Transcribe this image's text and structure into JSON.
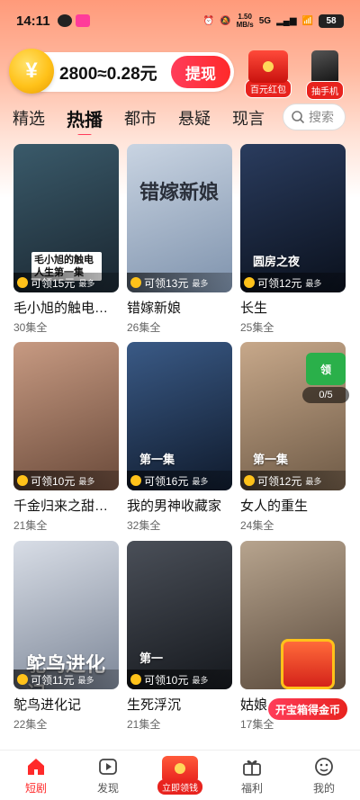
{
  "status_bar": {
    "time": "14:11",
    "net_speed_value": "1.50",
    "net_speed_unit": "MB/s",
    "network": "5G",
    "battery": "58"
  },
  "coin_bar": {
    "balance_text": "2800≈0.28元",
    "withdraw_label": "提现"
  },
  "promos": {
    "red_packet_label": "百元红包",
    "phone_label": "抽手机"
  },
  "tabs": [
    {
      "label": "精选",
      "active": false
    },
    {
      "label": "热播",
      "active": true
    },
    {
      "label": "都市",
      "active": false
    },
    {
      "label": "悬疑",
      "active": false
    },
    {
      "label": "现言",
      "active": false
    },
    {
      "label": "古",
      "active": false
    }
  ],
  "search": {
    "placeholder": "搜索"
  },
  "cards": [
    {
      "title": "毛小旭的触电…",
      "eps": "30集全",
      "reward": "可领15元",
      "max": "最多",
      "caption": "毛小旭的触电人生第一集",
      "color_a": "#3a5a6a",
      "color_b": "#1a2630"
    },
    {
      "title": "错嫁新娘",
      "eps": "26集全",
      "reward": "可领13元",
      "max": "最多",
      "caption": "错嫁新娘",
      "color_a": "#c9d4e2",
      "color_b": "#7f93ad"
    },
    {
      "title": "长生",
      "eps": "25集全",
      "reward": "可领12元",
      "max": "最多",
      "caption": "圆房之夜",
      "color_a": "#2a3c5e",
      "color_b": "#0a101c"
    },
    {
      "title": "千金归来之甜…",
      "eps": "21集全",
      "reward": "可领10元",
      "max": "最多",
      "caption": "",
      "color_a": "#c79a82",
      "color_b": "#6a4a3a"
    },
    {
      "title": "我的男神收藏家",
      "eps": "32集全",
      "reward": "可领16元",
      "max": "最多",
      "caption": "第一集",
      "color_a": "#3a5a86",
      "color_b": "#0f1a2c"
    },
    {
      "title": "女人的重生",
      "eps": "24集全",
      "reward": "可领12元",
      "max": "最多",
      "caption": "第一集",
      "color_a": "#c7a88a",
      "color_b": "#6e5a46"
    },
    {
      "title": "鸵鸟进化记",
      "eps": "22集全",
      "reward": "可领11元",
      "max": "最多",
      "caption": "鸵鸟进化记",
      "color_a": "#d8dde6",
      "color_b": "#7d8798"
    },
    {
      "title": "生死浮沉",
      "eps": "21集全",
      "reward": "可领10元",
      "max": "最多",
      "caption": "第一",
      "color_a": "#4a4f58",
      "color_b": "#15181d"
    },
    {
      "title": "姑娘…",
      "eps": "17集全",
      "reward": "",
      "max": "",
      "caption": "",
      "color_a": "#b7a48e",
      "color_b": "#5a4a3c"
    }
  ],
  "progress_badge": {
    "icon_label": "领",
    "count": "0/5"
  },
  "chest_button": "开宝箱得金币",
  "bottom_nav": [
    {
      "label": "短剧",
      "active": true
    },
    {
      "label": "发现",
      "active": false
    },
    {
      "label": "立即领钱",
      "active": false
    },
    {
      "label": "福利",
      "active": false
    },
    {
      "label": "我的",
      "active": false
    }
  ],
  "colors": {
    "accent": "#ff2a2a",
    "coin": "#ffc21a",
    "header_gradient_top": "#ff9a7a"
  }
}
